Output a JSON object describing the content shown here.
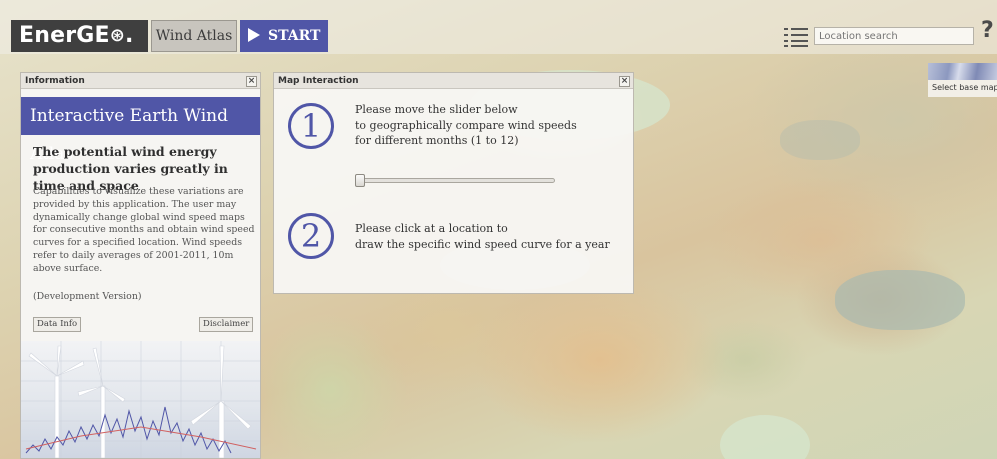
{
  "header": {
    "logo_text": "EnerGE",
    "logo_suffix": ".",
    "wind_atlas_label": "Wind Atlas",
    "start_label": "START",
    "search_placeholder": "Location search",
    "help_label": "?"
  },
  "basemap": {
    "label": "Select base map"
  },
  "info_panel": {
    "title": "Information",
    "close": "×",
    "header": "Interactive Earth Wind Atlas",
    "heading": "The potential wind energy production varies greatly in time and space",
    "body": "Capabilities to visualize these variations are provided by this application. The user may dynamically change global wind speed maps for consecutive months and obtain wind speed curves for a specified location. Wind speeds refer to daily averages of 2001-2011, 10m above surface.",
    "dev_note": "(Development Version)",
    "data_info_label": "Data Info",
    "disclaimer_label": "Disclaimer"
  },
  "map_panel": {
    "title": "Map Interaction",
    "close": "×",
    "step1_number": "1",
    "step1_line1": "Please move the slider below",
    "step1_line2": "to geographically compare wind speeds",
    "step1_line3": "for different months (1 to 12)",
    "slider_month": 1,
    "slider_min": 1,
    "slider_max": 12,
    "step2_number": "2",
    "step2_line1": "Please click at a location to",
    "step2_line2": "draw the specific wind speed curve for a year"
  },
  "colors": {
    "accent": "#5056a7",
    "logo_bg": "#3f3f3f",
    "panel_bg": "#f6f5f2"
  }
}
